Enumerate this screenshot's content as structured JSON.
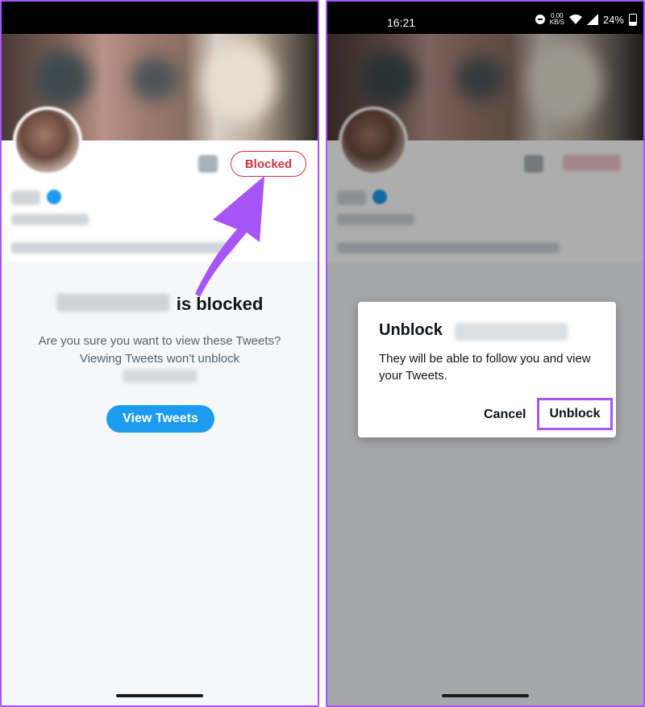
{
  "left_screen": {
    "blocked_button_label": "Blocked",
    "blocked_heading_suffix": "is blocked",
    "description": "Are you sure you want to view these Tweets? Viewing Tweets won't unblock",
    "view_tweets_label": "View Tweets"
  },
  "right_screen": {
    "status_bar": {
      "time": "16:21",
      "net_speed_value": "0.00",
      "net_speed_unit": "KB/S",
      "battery_percent": "24%"
    },
    "dialog": {
      "title": "Unblock",
      "body": "They will be able to follow you and view your Tweets.",
      "cancel_label": "Cancel",
      "unblock_label": "Unblock"
    }
  },
  "colors": {
    "highlight": "#a855f7",
    "blocked_red": "#d0333d",
    "twitter_blue": "#1d9bf0"
  }
}
